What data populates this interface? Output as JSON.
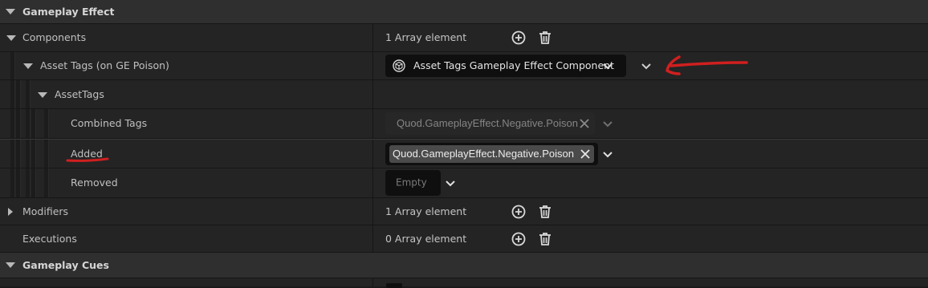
{
  "categories": {
    "gameplay_effect": "Gameplay Effect",
    "gameplay_cues": "Gameplay Cues"
  },
  "rows": {
    "components": {
      "label": "Components",
      "value": "1 Array element"
    },
    "asset_tags_on": {
      "label": "Asset Tags (on GE Poison)",
      "dropdown": "Asset Tags Gameplay Effect Component"
    },
    "asset_tags": {
      "label": "AssetTags"
    },
    "combined_tags": {
      "label": "Combined Tags",
      "tag": "Quod.GameplayEffect.Negative.Poison"
    },
    "added": {
      "label": "Added",
      "tag": "Quod.GameplayEffect.Negative.Poison"
    },
    "removed": {
      "label": "Removed",
      "value": "Empty"
    },
    "modifiers": {
      "label": "Modifiers",
      "value": "1 Array element"
    },
    "executions": {
      "label": "Executions",
      "value": "0 Array element"
    }
  },
  "icons": {
    "add": "plus-circle-icon",
    "delete": "trash-icon",
    "component": "component-cube-icon",
    "clear": "close-icon",
    "dropdown": "chevron-down-icon"
  },
  "colors": {
    "annotation": "#d01f1f",
    "tag_active_bg": "#4a4a4a",
    "tag_disabled_bg": "#272727"
  }
}
